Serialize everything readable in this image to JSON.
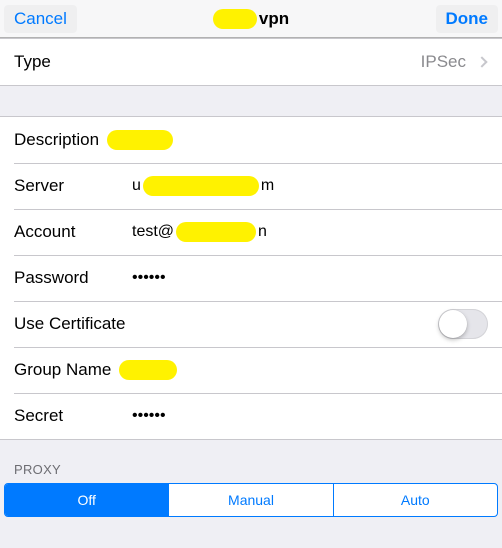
{
  "navbar": {
    "cancel_label": "Cancel",
    "done_label": "Done",
    "title_suffix": "vpn",
    "title_redaction_width": 44
  },
  "type_row": {
    "label": "Type",
    "value": "IPSec"
  },
  "fields": {
    "description": {
      "label": "Description",
      "redaction_width": 66
    },
    "server": {
      "label": "Server",
      "prefix": "u",
      "redaction_width": 116,
      "suffix": "m"
    },
    "account": {
      "label": "Account",
      "prefix": "test@",
      "redaction_width": 80,
      "suffix": "n"
    },
    "password": {
      "label": "Password",
      "value": "••••••"
    },
    "use_certificate": {
      "label": "Use Certificate",
      "on": false
    },
    "group_name": {
      "label": "Group Name",
      "redaction_width": 58
    },
    "secret": {
      "label": "Secret",
      "value": "••••••"
    }
  },
  "proxy": {
    "header": "PROXY",
    "segments": {
      "off": "Off",
      "manual": "Manual",
      "auto": "Auto"
    },
    "selected": "off"
  }
}
